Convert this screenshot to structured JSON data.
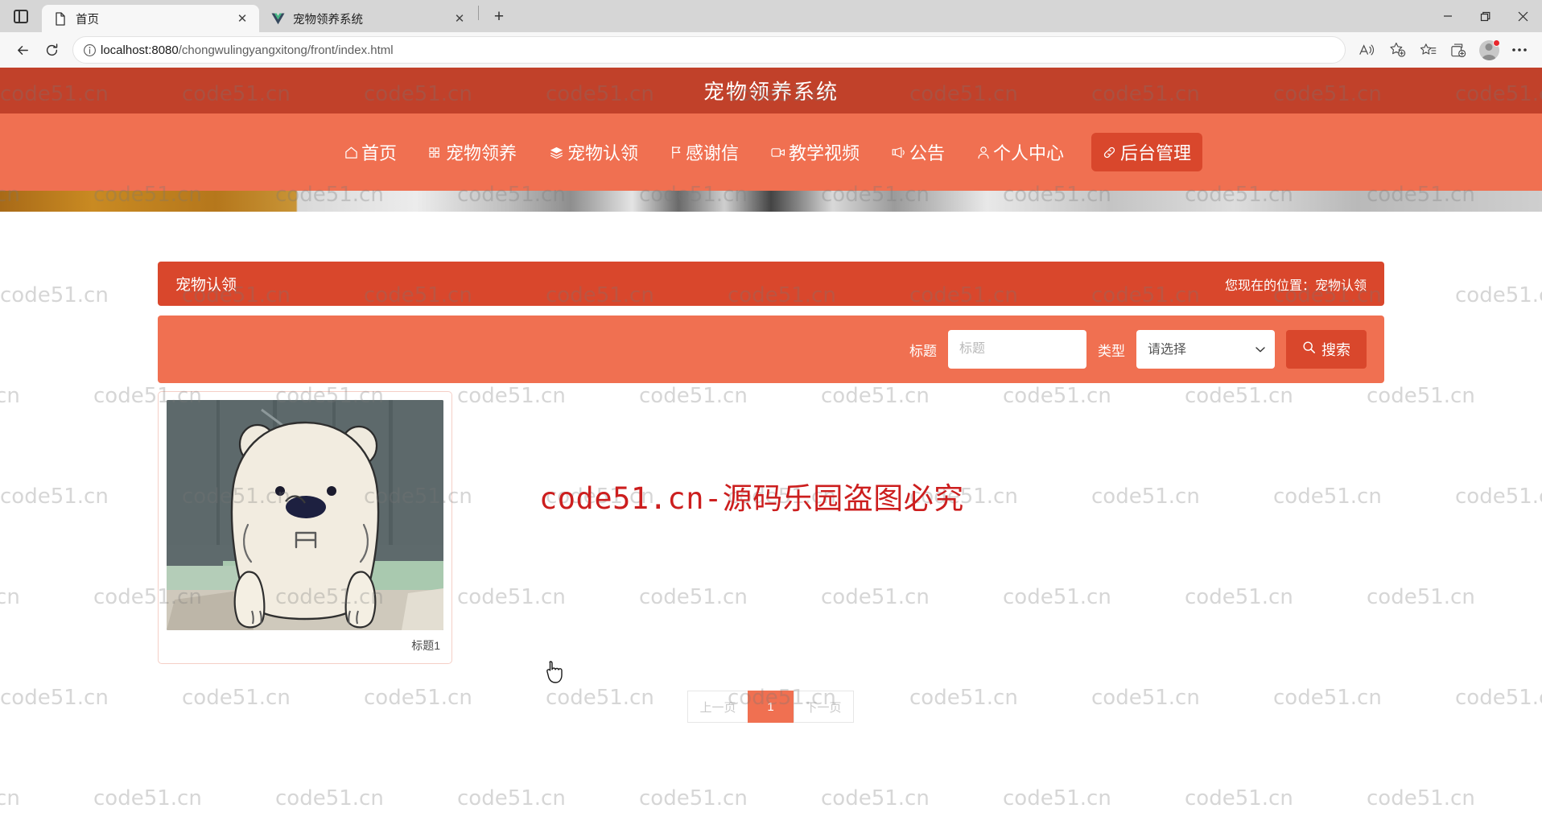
{
  "browser": {
    "tab_search_icon": "tab-list-icon",
    "tabs": [
      {
        "title": "首页",
        "favicon": "document-icon",
        "active": true,
        "close_label": "✕"
      },
      {
        "title": "宠物领养系统",
        "favicon": "vue-logo-icon",
        "active": false,
        "close_label": "✕"
      }
    ],
    "new_tab_label": "+",
    "window_controls": {
      "minimize": "minimize-icon",
      "maximize": "restore-icon",
      "close": "close-icon"
    },
    "toolbar": {
      "back": "back-arrow-icon",
      "reload": "reload-icon",
      "info": "info-circle-icon",
      "url_host": "localhost:8080",
      "url_path": "/chongwulingyangxitong/front/index.html",
      "read_aloud": "read-aloud-icon",
      "add_favorite": "add-favorite-icon",
      "favorites": "favorites-icon",
      "collections": "collections-icon",
      "profile": "profile-avatar-icon",
      "settings": "more-options-icon"
    }
  },
  "site": {
    "title": "宠物领养系统",
    "accent_dark": "#c1412a",
    "accent": "#f07051",
    "accent_button": "#d9472c",
    "nav": [
      {
        "label": "首页",
        "icon": "home-icon"
      },
      {
        "label": "宠物领养",
        "icon": "grid-icon"
      },
      {
        "label": "宠物认领",
        "icon": "layers-icon"
      },
      {
        "label": "感谢信",
        "icon": "flag-icon"
      },
      {
        "label": "教学视频",
        "icon": "video-icon"
      },
      {
        "label": "公告",
        "icon": "speaker-icon"
      },
      {
        "label": "个人中心",
        "icon": "user-icon"
      },
      {
        "label": "后台管理",
        "icon": "link-icon",
        "cta": true
      }
    ]
  },
  "breadcrumb": {
    "title": "宠物认领",
    "position_text": "您现在的位置：宠物认领"
  },
  "search": {
    "title_label": "标题",
    "title_placeholder": "标题",
    "title_value": "",
    "type_label": "类型",
    "type_selected": "请选择",
    "type_options": [
      "请选择"
    ],
    "button_label": "搜索",
    "button_icon": "search-icon"
  },
  "cards": [
    {
      "caption": "标题1",
      "image": "polar-bear-photo"
    }
  ],
  "pagination": {
    "prev_label": "上一页",
    "next_label": "下一页",
    "pages": [
      "1"
    ],
    "current": "1"
  },
  "overlays": {
    "red_watermark": "code51.cn-源码乐园盗图必究",
    "tiled_watermark": "code51.cn"
  }
}
